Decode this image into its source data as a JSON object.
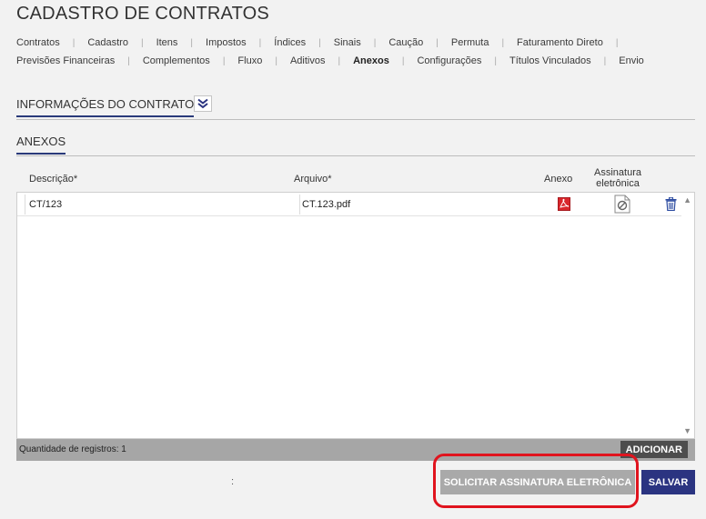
{
  "page": {
    "title": "CADASTRO DE CONTRATOS"
  },
  "nav": {
    "row1": [
      "Contratos",
      "Cadastro",
      "Itens",
      "Impostos",
      "Índices",
      "Sinais",
      "Caução",
      "Permuta",
      "Faturamento Direto"
    ],
    "row2": [
      "Previsões Financeiras",
      "Complementos",
      "Fluxo",
      "Aditivos",
      "Anexos",
      "Configurações",
      "Títulos Vinculados",
      "Envio"
    ],
    "active": "Anexos"
  },
  "sections": {
    "info_title": "INFORMAÇÕES DO CONTRATO",
    "anexos_title": "ANEXOS"
  },
  "table": {
    "columns": {
      "descricao": "Descrição*",
      "arquivo": "Arquivo*",
      "anexo": "Anexo",
      "assinatura_line1": "Assinatura",
      "assinatura_line2": "eletrônica"
    },
    "rows": [
      {
        "descricao": "CT/123",
        "arquivo": "CT.123.pdf"
      }
    ],
    "count_label": "Quantidade de registros: 1"
  },
  "buttons": {
    "add": "ADICIONAR",
    "sign": "SOLICITAR ASSINATURA ELETRÔNICA",
    "save": "SALVAR"
  },
  "misc": {
    "colon": ":"
  },
  "icons": {
    "expand": "chevron-double-down-icon",
    "pdf": "pdf-icon",
    "signature": "signature-blocked-icon",
    "trash": "trash-icon"
  },
  "colors": {
    "primary": "#2b3481",
    "highlight": "#e0141e",
    "pdf_red": "#d9262c",
    "disabled_button": "#a9a9a9"
  }
}
